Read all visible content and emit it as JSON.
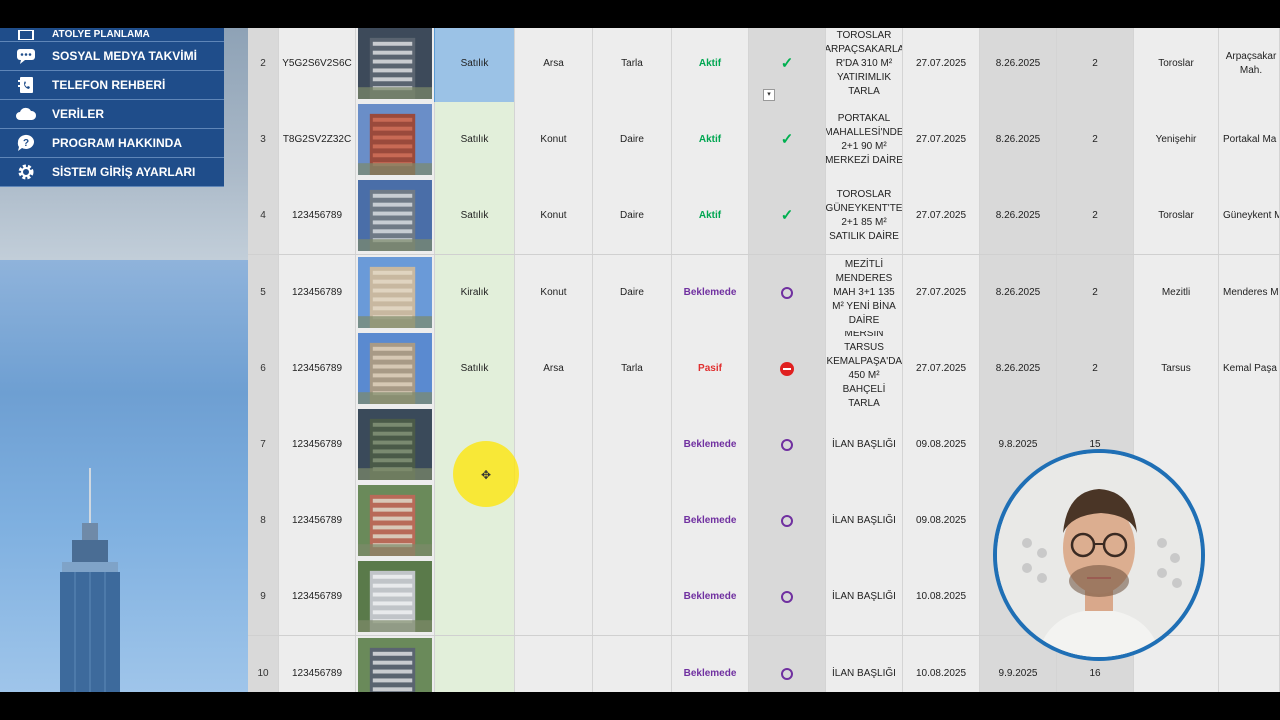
{
  "menu": {
    "items": [
      {
        "label": "ATÖLYE PLANLAMA",
        "icon": "calendar-icon"
      },
      {
        "label": "SOSYAL MEDYA TAKVİMİ",
        "icon": "chat-icon"
      },
      {
        "label": "TELEFON REHBERİ",
        "icon": "phone-book-icon"
      },
      {
        "label": "VERİLER",
        "icon": "cloud-icon"
      },
      {
        "label": "PROGRAM HAKKINDA",
        "icon": "help-icon"
      },
      {
        "label": "SİSTEM GİRİŞ AYARLARI",
        "icon": "gear-icon"
      }
    ]
  },
  "colors": {
    "menu_bg": "#1f4d8a",
    "aktif": "#00a651",
    "beklemede": "#7030a0",
    "pasif": "#e03030",
    "webcam_border": "#1f6fb5"
  },
  "rows": [
    {
      "no": "2",
      "code": "Y5G2S6V2S6C",
      "type": "Satılık",
      "category": "Arsa",
      "subcategory": "Tarla",
      "status": "Aktif",
      "status_kind": "aktif",
      "title": "TOROSLAR ARPAÇSAKARLA R'DA 310 M² YATIRIMLIK TARLA",
      "date1": "27.07.2025",
      "date2": "8.26.2025",
      "count": "2",
      "district": "Toroslar",
      "neighborhood": "Arpaçsakar Mah."
    },
    {
      "no": "3",
      "code": "T8G2SV2Z32C",
      "type": "Satılık",
      "category": "Konut",
      "subcategory": "Daire",
      "status": "Aktif",
      "status_kind": "aktif",
      "title": "PORTAKAL MAHALLESİ'NDE 2+1 90 M² MERKEZİ DAİRE",
      "date1": "27.07.2025",
      "date2": "8.26.2025",
      "count": "2",
      "district": "Yenişehir",
      "neighborhood": "Portakal Ma"
    },
    {
      "no": "4",
      "code": "123456789",
      "type": "Satılık",
      "category": "Konut",
      "subcategory": "Daire",
      "status": "Aktif",
      "status_kind": "aktif",
      "title": "TOROSLAR GÜNEYKENT'TE 2+1 85 M² SATILIK DAİRE",
      "date1": "27.07.2025",
      "date2": "8.26.2025",
      "count": "2",
      "district": "Toroslar",
      "neighborhood": "Güneykent M"
    },
    {
      "no": "5",
      "code": "123456789",
      "type": "Kiralık",
      "category": "Konut",
      "subcategory": "Daire",
      "status": "Beklemede",
      "status_kind": "bek",
      "title": "MEZİTLİ MENDERES MAH 3+1 135 M² YENİ BİNA DAİRE",
      "date1": "27.07.2025",
      "date2": "8.26.2025",
      "count": "2",
      "district": "Mezitli",
      "neighborhood": "Menderes M"
    },
    {
      "no": "6",
      "code": "123456789",
      "type": "Satılık",
      "category": "Arsa",
      "subcategory": "Tarla",
      "status": "Pasif",
      "status_kind": "pasif",
      "title": "MERSİN TARSUS KEMALPAŞA'DA 450 M² BAHÇELİ TARLA",
      "date1": "27.07.2025",
      "date2": "8.26.2025",
      "count": "2",
      "district": "Tarsus",
      "neighborhood": "Kemal Paşa M"
    },
    {
      "no": "7",
      "code": "123456789",
      "type": "",
      "category": "",
      "subcategory": "",
      "status": "Beklemede",
      "status_kind": "bek",
      "title": "İLAN BAŞLIĞI",
      "date1": "09.08.2025",
      "date2": "9.8.2025",
      "count": "15",
      "district": "",
      "neighborhood": ""
    },
    {
      "no": "8",
      "code": "123456789",
      "type": "",
      "category": "",
      "subcategory": "",
      "status": "Beklemede",
      "status_kind": "bek",
      "title": "İLAN BAŞLIĞI",
      "date1": "09.08.2025",
      "date2": "",
      "count": "",
      "district": "",
      "neighborhood": ""
    },
    {
      "no": "9",
      "code": "123456789",
      "type": "",
      "category": "",
      "subcategory": "",
      "status": "Beklemede",
      "status_kind": "bek",
      "title": "İLAN BAŞLIĞI",
      "date1": "10.08.2025",
      "date2": "",
      "count": "",
      "district": "",
      "neighborhood": ""
    },
    {
      "no": "10",
      "code": "123456789",
      "type": "",
      "category": "",
      "subcategory": "",
      "status": "Beklemede",
      "status_kind": "bek",
      "title": "İLAN BAŞLIĞI",
      "date1": "10.08.2025",
      "date2": "9.9.2025",
      "count": "16",
      "district": "",
      "neighborhood": ""
    }
  ]
}
